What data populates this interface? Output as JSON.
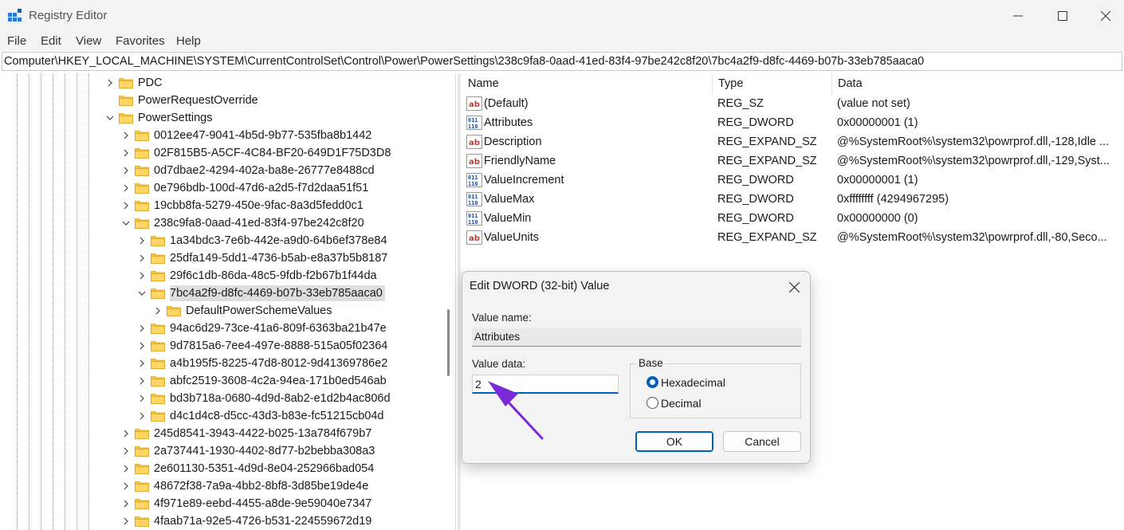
{
  "window": {
    "title": "Registry Editor",
    "minimize_icon": "minimize-icon",
    "maximize_icon": "maximize-icon",
    "close_icon": "close-icon"
  },
  "menu": [
    "File",
    "Edit",
    "View",
    "Favorites",
    "Help"
  ],
  "address": "Computer\\HKEY_LOCAL_MACHINE\\SYSTEM\\CurrentControlSet\\Control\\Power\\PowerSettings\\238c9fa8-0aad-41ed-83f4-97be242c8f20\\7bc4a2f9-d8fc-4469-b07b-33eb785aaca0",
  "tree": [
    {
      "label": "PDC",
      "level": 0,
      "expander": "collapsed"
    },
    {
      "label": "PowerRequestOverride",
      "level": 0,
      "expander": "none"
    },
    {
      "label": "PowerSettings",
      "level": 0,
      "expander": "expanded"
    },
    {
      "label": "0012ee47-9041-4b5d-9b77-535fba8b1442",
      "level": 1,
      "expander": "collapsed"
    },
    {
      "label": "02F815B5-A5CF-4C84-BF20-649D1F75D3D8",
      "level": 1,
      "expander": "collapsed"
    },
    {
      "label": "0d7dbae2-4294-402a-ba8e-26777e8488cd",
      "level": 1,
      "expander": "collapsed"
    },
    {
      "label": "0e796bdb-100d-47d6-a2d5-f7d2daa51f51",
      "level": 1,
      "expander": "collapsed"
    },
    {
      "label": "19cbb8fa-5279-450e-9fac-8a3d5fedd0c1",
      "level": 1,
      "expander": "collapsed"
    },
    {
      "label": "238c9fa8-0aad-41ed-83f4-97be242c8f20",
      "level": 1,
      "expander": "expanded"
    },
    {
      "label": "1a34bdc3-7e6b-442e-a9d0-64b6ef378e84",
      "level": 2,
      "expander": "collapsed"
    },
    {
      "label": "25dfa149-5dd1-4736-b5ab-e8a37b5b8187",
      "level": 2,
      "expander": "collapsed"
    },
    {
      "label": "29f6c1db-86da-48c5-9fdb-f2b67b1f44da",
      "level": 2,
      "expander": "collapsed"
    },
    {
      "label": "7bc4a2f9-d8fc-4469-b07b-33eb785aaca0",
      "level": 2,
      "expander": "expanded",
      "selected": true
    },
    {
      "label": "DefaultPowerSchemeValues",
      "level": 3,
      "expander": "collapsed"
    },
    {
      "label": "94ac6d29-73ce-41a6-809f-6363ba21b47e",
      "level": 2,
      "expander": "collapsed"
    },
    {
      "label": "9d7815a6-7ee4-497e-8888-515a05f02364",
      "level": 2,
      "expander": "collapsed"
    },
    {
      "label": "a4b195f5-8225-47d8-8012-9d41369786e2",
      "level": 2,
      "expander": "collapsed"
    },
    {
      "label": "abfc2519-3608-4c2a-94ea-171b0ed546ab",
      "level": 2,
      "expander": "collapsed"
    },
    {
      "label": "bd3b718a-0680-4d9d-8ab2-e1d2b4ac806d",
      "level": 2,
      "expander": "collapsed"
    },
    {
      "label": "d4c1d4c8-d5cc-43d3-b83e-fc51215cb04d",
      "level": 2,
      "expander": "collapsed"
    },
    {
      "label": "245d8541-3943-4422-b025-13a784f679b7",
      "level": 1,
      "expander": "collapsed"
    },
    {
      "label": "2a737441-1930-4402-8d77-b2bebba308a3",
      "level": 1,
      "expander": "collapsed"
    },
    {
      "label": "2e601130-5351-4d9d-8e04-252966bad054",
      "level": 1,
      "expander": "collapsed"
    },
    {
      "label": "48672f38-7a9a-4bb2-8bf8-3d85be19de4e",
      "level": 1,
      "expander": "collapsed"
    },
    {
      "label": "4f971e89-eebd-4455-a8de-9e59040e7347",
      "level": 1,
      "expander": "collapsed"
    },
    {
      "label": "4faab71a-92e5-4726-b531-224559672d19",
      "level": 1,
      "expander": "collapsed"
    }
  ],
  "values_header": {
    "name": "Name",
    "type": "Type",
    "data": "Data"
  },
  "values": [
    {
      "name": "(Default)",
      "type": "REG_SZ",
      "data": "(value not set)",
      "icon": "string-value-icon"
    },
    {
      "name": "Attributes",
      "type": "REG_DWORD",
      "data": "0x00000001 (1)",
      "icon": "binary-value-icon"
    },
    {
      "name": "Description",
      "type": "REG_EXPAND_SZ",
      "data": "@%SystemRoot%\\system32\\powrprof.dll,-128,Idle ...",
      "icon": "string-value-icon"
    },
    {
      "name": "FriendlyName",
      "type": "REG_EXPAND_SZ",
      "data": "@%SystemRoot%\\system32\\powrprof.dll,-129,Syst...",
      "icon": "string-value-icon"
    },
    {
      "name": "ValueIncrement",
      "type": "REG_DWORD",
      "data": "0x00000001 (1)",
      "icon": "binary-value-icon"
    },
    {
      "name": "ValueMax",
      "type": "REG_DWORD",
      "data": "0xffffffff (4294967295)",
      "icon": "binary-value-icon"
    },
    {
      "name": "ValueMin",
      "type": "REG_DWORD",
      "data": "0x00000000 (0)",
      "icon": "binary-value-icon"
    },
    {
      "name": "ValueUnits",
      "type": "REG_EXPAND_SZ",
      "data": "@%SystemRoot%\\system32\\powrprof.dll,-80,Seco...",
      "icon": "string-value-icon"
    }
  ],
  "dialog": {
    "title": "Edit DWORD (32-bit) Value",
    "value_name_label": "Value name:",
    "value_name": "Attributes",
    "value_data_label": "Value data:",
    "value_data": "2",
    "base_label": "Base",
    "hex_label": "Hexadecimal",
    "dec_label": "Decimal",
    "base_selected": "Hexadecimal",
    "ok_label": "OK",
    "cancel_label": "Cancel"
  },
  "colors": {
    "accent": "#005fb8",
    "annotation_arrow": "#7a2bd6",
    "folder": "#f5c542"
  }
}
